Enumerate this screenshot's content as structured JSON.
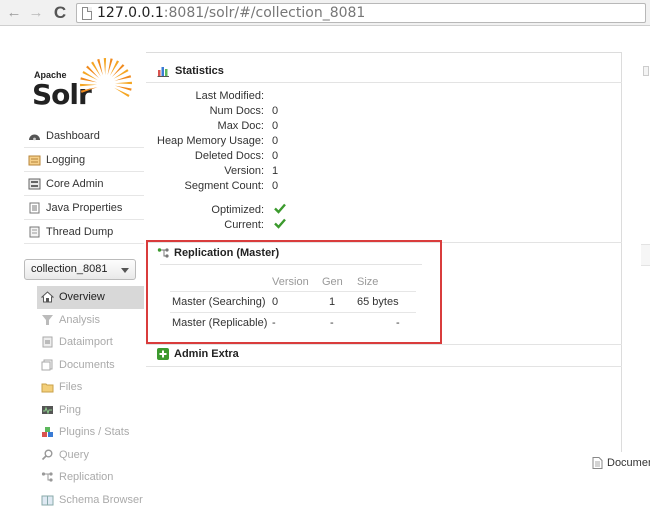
{
  "browser": {
    "url_host": "127.0.0.1",
    "url_rest": ":8081/solr/#/collection_8081"
  },
  "logo": {
    "apache": "Apache",
    "solr": "Solr"
  },
  "sidebar": {
    "items": [
      {
        "label": "Dashboard",
        "icon": "dashboard-icon"
      },
      {
        "label": "Logging",
        "icon": "logging-icon"
      },
      {
        "label": "Core Admin",
        "icon": "core-admin-icon"
      },
      {
        "label": "Java Properties",
        "icon": "java-properties-icon"
      },
      {
        "label": "Thread Dump",
        "icon": "thread-dump-icon"
      }
    ]
  },
  "core_selector": {
    "value": "collection_8081"
  },
  "core_menu": {
    "items": [
      {
        "label": "Overview",
        "icon": "overview-icon",
        "active": true
      },
      {
        "label": "Analysis",
        "icon": "analysis-icon"
      },
      {
        "label": "Dataimport",
        "icon": "dataimport-icon"
      },
      {
        "label": "Documents",
        "icon": "documents-icon"
      },
      {
        "label": "Files",
        "icon": "files-icon"
      },
      {
        "label": "Ping",
        "icon": "ping-icon"
      },
      {
        "label": "Plugins / Stats",
        "icon": "plugins-icon"
      },
      {
        "label": "Query",
        "icon": "query-icon"
      },
      {
        "label": "Replication",
        "icon": "replication-icon"
      },
      {
        "label": "Schema Browser",
        "icon": "schema-browser-icon"
      }
    ]
  },
  "statistics": {
    "title": "Statistics",
    "rows": [
      {
        "label": "Last Modified:",
        "value": ""
      },
      {
        "label": "Num Docs:",
        "value": "0"
      },
      {
        "label": "Max Doc:",
        "value": "0"
      },
      {
        "label": "Heap Memory Usage:",
        "value": "0"
      },
      {
        "label": "Deleted Docs:",
        "value": "0"
      },
      {
        "label": "Version:",
        "value": "1"
      },
      {
        "label": "Segment Count:",
        "value": "0"
      }
    ],
    "optimized_label": "Optimized:",
    "current_label": "Current:"
  },
  "replication": {
    "title": "Replication (Master)",
    "headers": {
      "version": "Version",
      "gen": "Gen",
      "size": "Size"
    },
    "rows": [
      {
        "label": "Master (Searching)",
        "version": "0",
        "gen": "1",
        "size": "65 bytes"
      },
      {
        "label": "Master (Replicable)",
        "version": "-",
        "gen": "-",
        "size": "-"
      }
    ]
  },
  "admin_extra": {
    "title": "Admin Extra"
  },
  "right_panel": {
    "doc_link": "Documen"
  },
  "colors": {
    "highlight": "#d93c3c",
    "check": "#3c9a2e",
    "accent": "#f08a1c"
  }
}
